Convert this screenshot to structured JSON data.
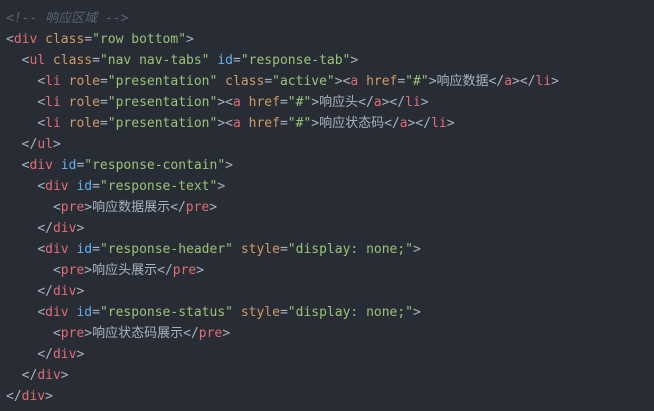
{
  "editor": {
    "lines": [
      {
        "indent": 0,
        "tokens": [
          {
            "t": "comment",
            "v": "<!-- 响应区域 -->"
          }
        ]
      },
      {
        "indent": 0,
        "tokens": [
          {
            "t": "punct",
            "v": "<"
          },
          {
            "t": "tag",
            "v": "div"
          },
          {
            "t": "text",
            "v": " "
          },
          {
            "t": "attr",
            "v": "class"
          },
          {
            "t": "punct",
            "v": "="
          },
          {
            "t": "str",
            "v": "\"row bottom\""
          },
          {
            "t": "punct",
            "v": ">"
          }
        ]
      },
      {
        "indent": 2,
        "tokens": [
          {
            "t": "punct",
            "v": "<"
          },
          {
            "t": "tag",
            "v": "ul"
          },
          {
            "t": "text",
            "v": " "
          },
          {
            "t": "attr",
            "v": "class"
          },
          {
            "t": "punct",
            "v": "="
          },
          {
            "t": "str",
            "v": "\"nav nav-tabs\""
          },
          {
            "t": "text",
            "v": " "
          },
          {
            "t": "attr-id",
            "v": "id"
          },
          {
            "t": "punct",
            "v": "="
          },
          {
            "t": "str",
            "v": "\"response-tab\""
          },
          {
            "t": "punct",
            "v": ">"
          }
        ]
      },
      {
        "indent": 4,
        "tokens": [
          {
            "t": "punct",
            "v": "<"
          },
          {
            "t": "tag",
            "v": "li"
          },
          {
            "t": "text",
            "v": " "
          },
          {
            "t": "attr",
            "v": "role"
          },
          {
            "t": "punct",
            "v": "="
          },
          {
            "t": "str",
            "v": "\"presentation\""
          },
          {
            "t": "text",
            "v": " "
          },
          {
            "t": "attr",
            "v": "class"
          },
          {
            "t": "punct",
            "v": "="
          },
          {
            "t": "str",
            "v": "\"active\""
          },
          {
            "t": "punct",
            "v": "><"
          },
          {
            "t": "tag",
            "v": "a"
          },
          {
            "t": "text",
            "v": " "
          },
          {
            "t": "attr",
            "v": "href"
          },
          {
            "t": "punct",
            "v": "="
          },
          {
            "t": "str",
            "v": "\"#\""
          },
          {
            "t": "punct",
            "v": ">"
          },
          {
            "t": "text",
            "v": "响应数据"
          },
          {
            "t": "punct",
            "v": "</"
          },
          {
            "t": "tag",
            "v": "a"
          },
          {
            "t": "punct",
            "v": "></"
          },
          {
            "t": "tag",
            "v": "li"
          },
          {
            "t": "punct",
            "v": ">"
          }
        ]
      },
      {
        "indent": 4,
        "tokens": [
          {
            "t": "punct",
            "v": "<"
          },
          {
            "t": "tag",
            "v": "li"
          },
          {
            "t": "text",
            "v": " "
          },
          {
            "t": "attr",
            "v": "role"
          },
          {
            "t": "punct",
            "v": "="
          },
          {
            "t": "str",
            "v": "\"presentation\""
          },
          {
            "t": "punct",
            "v": "><"
          },
          {
            "t": "tag",
            "v": "a"
          },
          {
            "t": "text",
            "v": " "
          },
          {
            "t": "attr",
            "v": "href"
          },
          {
            "t": "punct",
            "v": "="
          },
          {
            "t": "str",
            "v": "\"#\""
          },
          {
            "t": "punct",
            "v": ">"
          },
          {
            "t": "text",
            "v": "响应头"
          },
          {
            "t": "punct",
            "v": "</"
          },
          {
            "t": "tag",
            "v": "a"
          },
          {
            "t": "punct",
            "v": "></"
          },
          {
            "t": "tag",
            "v": "li"
          },
          {
            "t": "punct",
            "v": ">"
          }
        ]
      },
      {
        "indent": 4,
        "tokens": [
          {
            "t": "punct",
            "v": "<"
          },
          {
            "t": "tag",
            "v": "li"
          },
          {
            "t": "text",
            "v": " "
          },
          {
            "t": "attr",
            "v": "role"
          },
          {
            "t": "punct",
            "v": "="
          },
          {
            "t": "str",
            "v": "\"presentation\""
          },
          {
            "t": "punct",
            "v": "><"
          },
          {
            "t": "tag",
            "v": "a"
          },
          {
            "t": "text",
            "v": " "
          },
          {
            "t": "attr",
            "v": "href"
          },
          {
            "t": "punct",
            "v": "="
          },
          {
            "t": "str",
            "v": "\"#\""
          },
          {
            "t": "punct",
            "v": ">"
          },
          {
            "t": "text",
            "v": "响应状态码"
          },
          {
            "t": "punct",
            "v": "</"
          },
          {
            "t": "tag",
            "v": "a"
          },
          {
            "t": "punct",
            "v": "></"
          },
          {
            "t": "tag",
            "v": "li"
          },
          {
            "t": "punct",
            "v": ">"
          }
        ]
      },
      {
        "indent": 2,
        "tokens": [
          {
            "t": "punct",
            "v": "</"
          },
          {
            "t": "tag",
            "v": "ul"
          },
          {
            "t": "punct",
            "v": ">"
          }
        ]
      },
      {
        "indent": 2,
        "tokens": [
          {
            "t": "punct",
            "v": "<"
          },
          {
            "t": "tag",
            "v": "div"
          },
          {
            "t": "text",
            "v": " "
          },
          {
            "t": "attr-id",
            "v": "id"
          },
          {
            "t": "punct",
            "v": "="
          },
          {
            "t": "str",
            "v": "\"response-contain\""
          },
          {
            "t": "punct",
            "v": ">"
          }
        ]
      },
      {
        "indent": 4,
        "tokens": [
          {
            "t": "punct",
            "v": "<"
          },
          {
            "t": "tag",
            "v": "div"
          },
          {
            "t": "text",
            "v": " "
          },
          {
            "t": "attr-id",
            "v": "id"
          },
          {
            "t": "punct",
            "v": "="
          },
          {
            "t": "str",
            "v": "\"response-text\""
          },
          {
            "t": "punct",
            "v": ">"
          }
        ]
      },
      {
        "indent": 6,
        "tokens": [
          {
            "t": "punct",
            "v": "<"
          },
          {
            "t": "tag",
            "v": "pre"
          },
          {
            "t": "punct",
            "v": ">"
          },
          {
            "t": "text",
            "v": "响应数据展示"
          },
          {
            "t": "punct",
            "v": "</"
          },
          {
            "t": "tag",
            "v": "pre"
          },
          {
            "t": "punct",
            "v": ">"
          }
        ]
      },
      {
        "indent": 4,
        "tokens": [
          {
            "t": "punct",
            "v": "</"
          },
          {
            "t": "tag",
            "v": "div"
          },
          {
            "t": "punct",
            "v": ">"
          }
        ]
      },
      {
        "indent": 4,
        "tokens": [
          {
            "t": "punct",
            "v": "<"
          },
          {
            "t": "tag",
            "v": "div"
          },
          {
            "t": "text",
            "v": " "
          },
          {
            "t": "attr-id",
            "v": "id"
          },
          {
            "t": "punct",
            "v": "="
          },
          {
            "t": "str",
            "v": "\"response-header\""
          },
          {
            "t": "text",
            "v": " "
          },
          {
            "t": "attr",
            "v": "style"
          },
          {
            "t": "punct",
            "v": "="
          },
          {
            "t": "str",
            "v": "\"display: none;\""
          },
          {
            "t": "punct",
            "v": ">"
          }
        ]
      },
      {
        "indent": 6,
        "tokens": [
          {
            "t": "punct",
            "v": "<"
          },
          {
            "t": "tag",
            "v": "pre"
          },
          {
            "t": "punct",
            "v": ">"
          },
          {
            "t": "text",
            "v": "响应头展示"
          },
          {
            "t": "punct",
            "v": "</"
          },
          {
            "t": "tag",
            "v": "pre"
          },
          {
            "t": "punct",
            "v": ">"
          }
        ]
      },
      {
        "indent": 4,
        "tokens": [
          {
            "t": "punct",
            "v": "</"
          },
          {
            "t": "tag",
            "v": "div"
          },
          {
            "t": "punct",
            "v": ">"
          }
        ]
      },
      {
        "indent": 4,
        "tokens": [
          {
            "t": "punct",
            "v": "<"
          },
          {
            "t": "tag",
            "v": "div"
          },
          {
            "t": "text",
            "v": " "
          },
          {
            "t": "attr-id",
            "v": "id"
          },
          {
            "t": "punct",
            "v": "="
          },
          {
            "t": "str",
            "v": "\"response-status\""
          },
          {
            "t": "text",
            "v": " "
          },
          {
            "t": "attr",
            "v": "style"
          },
          {
            "t": "punct",
            "v": "="
          },
          {
            "t": "str",
            "v": "\"display: none;\""
          },
          {
            "t": "punct",
            "v": ">"
          }
        ]
      },
      {
        "indent": 6,
        "tokens": [
          {
            "t": "punct",
            "v": "<"
          },
          {
            "t": "tag",
            "v": "pre"
          },
          {
            "t": "punct",
            "v": ">"
          },
          {
            "t": "text",
            "v": "响应状态码展示"
          },
          {
            "t": "punct",
            "v": "</"
          },
          {
            "t": "tag",
            "v": "pre"
          },
          {
            "t": "punct",
            "v": ">"
          }
        ]
      },
      {
        "indent": 4,
        "tokens": [
          {
            "t": "punct",
            "v": "</"
          },
          {
            "t": "tag",
            "v": "div"
          },
          {
            "t": "punct",
            "v": ">"
          }
        ]
      },
      {
        "indent": 2,
        "tokens": [
          {
            "t": "punct",
            "v": "</"
          },
          {
            "t": "tag",
            "v": "div"
          },
          {
            "t": "punct",
            "v": ">"
          }
        ]
      },
      {
        "indent": 0,
        "tokens": [
          {
            "t": "punct",
            "v": "</"
          },
          {
            "t": "tag",
            "v": "div"
          },
          {
            "t": "punct",
            "v": ">"
          }
        ]
      }
    ]
  }
}
